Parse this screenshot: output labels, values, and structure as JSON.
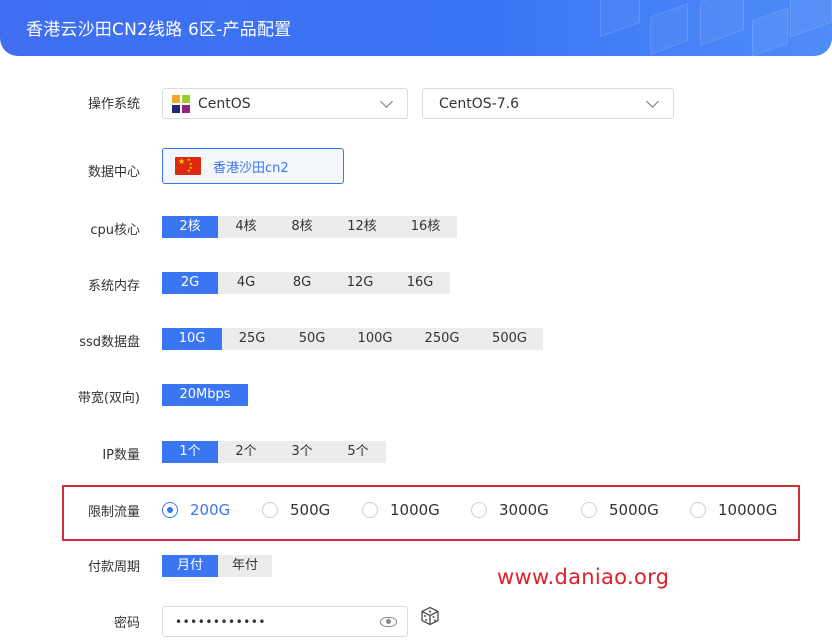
{
  "header": {
    "title": "香港云沙田CN2线路 6区-产品配置"
  },
  "os": {
    "label": "操作系统",
    "family": "CentOS",
    "version": "CentOS-7.6",
    "family_icon": "centos-icon"
  },
  "datacenter": {
    "label": "数据中心",
    "name": "香港沙田cn2",
    "flag_icon": "china-flag-icon"
  },
  "cpu": {
    "label": "cpu核心",
    "options": [
      "2核",
      "4核",
      "8核",
      "12核",
      "16核"
    ],
    "selected": "2核"
  },
  "memory": {
    "label": "系统内存",
    "options": [
      "2G",
      "4G",
      "8G",
      "12G",
      "16G"
    ],
    "selected": "2G"
  },
  "disk": {
    "label": "ssd数据盘",
    "options": [
      "10G",
      "25G",
      "50G",
      "100G",
      "250G",
      "500G"
    ],
    "selected": "10G"
  },
  "bandwidth": {
    "label": "带宽(双向)",
    "options": [
      "20Mbps"
    ],
    "selected": "20Mbps"
  },
  "ip": {
    "label": "IP数量",
    "options": [
      "1个",
      "2个",
      "3个",
      "5个"
    ],
    "selected": "1个"
  },
  "traffic": {
    "label": "限制流量",
    "options": [
      "200G",
      "500G",
      "1000G",
      "3000G",
      "5000G",
      "10000G"
    ],
    "selected": "200G"
  },
  "billing": {
    "label": "付款周期",
    "options": [
      "月付",
      "年付"
    ],
    "selected": "月付"
  },
  "password": {
    "label": "密码",
    "value": "••••••••••••",
    "toggle_icon": "eye-icon",
    "generate_icon": "dice-icon"
  },
  "watermark": "www.daniao.org",
  "colors": {
    "accent": "#3a76f4",
    "highlight_box": "#d0303a",
    "watermark": "#e0202a"
  }
}
